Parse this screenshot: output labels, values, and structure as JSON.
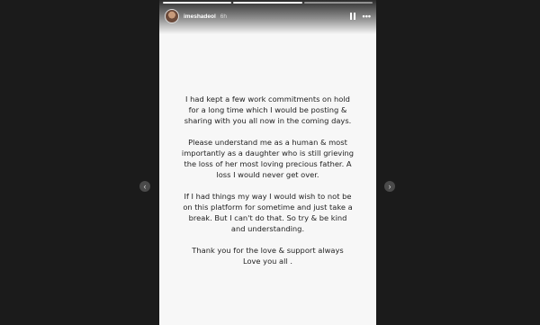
{
  "story": {
    "username": "imeshadeol",
    "time_ago": "6h",
    "progress": {
      "total_segments": 3,
      "completed_segments": 2
    },
    "icons": {
      "avatar": "profile-photo",
      "pause": "pause-icon",
      "more": "more-options-icon",
      "prev": "chevron-left-icon",
      "next": "chevron-right-icon"
    },
    "more_glyph": "•••",
    "prev_glyph": "‹",
    "next_glyph": "›"
  },
  "message": {
    "paragraphs": [
      [
        "I had kept a few work commitments on hold",
        "for a long time which I would be posting &",
        "sharing with you all now in the coming days."
      ],
      [
        "Please understand me as a human & most",
        "importantly as a daughter who is still grieving",
        "the loss of her most loving precious father. A",
        "loss I would never get over."
      ],
      [
        "If I had things my way I would wish to not be",
        "on this platform for sometime and just take a",
        "break. But I can't do that. So try & be kind",
        "and understanding."
      ],
      [
        "Thank you for the love & support always",
        "Love you all ."
      ]
    ]
  },
  "colors": {
    "background": "#1b1b1b",
    "story_background": "#f7f7f7",
    "text": "#222222"
  }
}
